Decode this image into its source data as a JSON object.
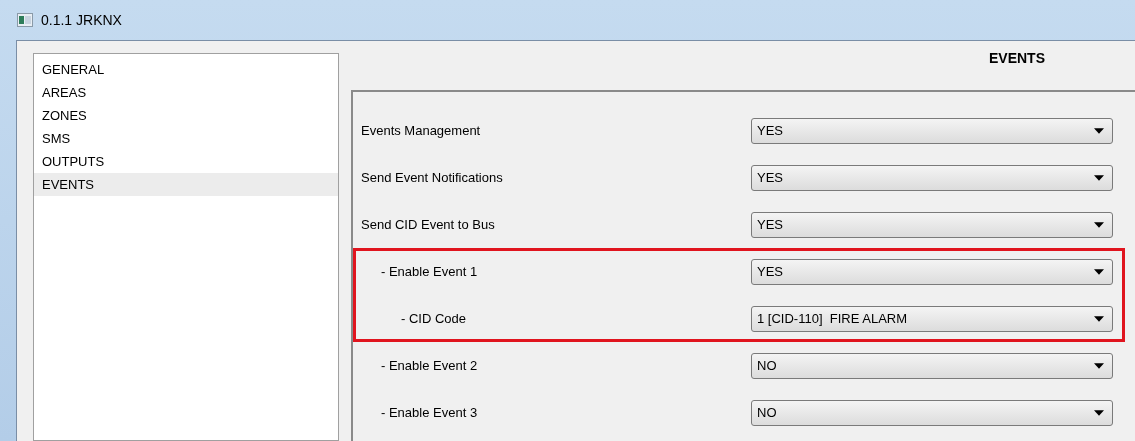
{
  "window": {
    "title": "0.1.1 JRKNX"
  },
  "sidebar": {
    "items": [
      {
        "label": "GENERAL",
        "selected": false
      },
      {
        "label": "AREAS",
        "selected": false
      },
      {
        "label": "ZONES",
        "selected": false
      },
      {
        "label": "SMS",
        "selected": false
      },
      {
        "label": "OUTPUTS",
        "selected": false
      },
      {
        "label": "EVENTS",
        "selected": true
      }
    ]
  },
  "panel": {
    "heading": "EVENTS",
    "parameters": [
      {
        "label": "Events Management",
        "value": "YES"
      },
      {
        "label": "Send Event Notifications",
        "value": "YES"
      },
      {
        "label": "Send CID Event to Bus",
        "value": "YES",
        "children": [
          {
            "label": "- Enable Event 1",
            "value": "YES",
            "highlighted": true,
            "children": [
              {
                "label": "- CID Code",
                "value": "1 [CID-110]  FIRE ALARM"
              }
            ]
          },
          {
            "label": "- Enable Event 2",
            "value": "NO"
          },
          {
            "label": "- Enable Event 3",
            "value": "NO"
          }
        ]
      }
    ]
  }
}
